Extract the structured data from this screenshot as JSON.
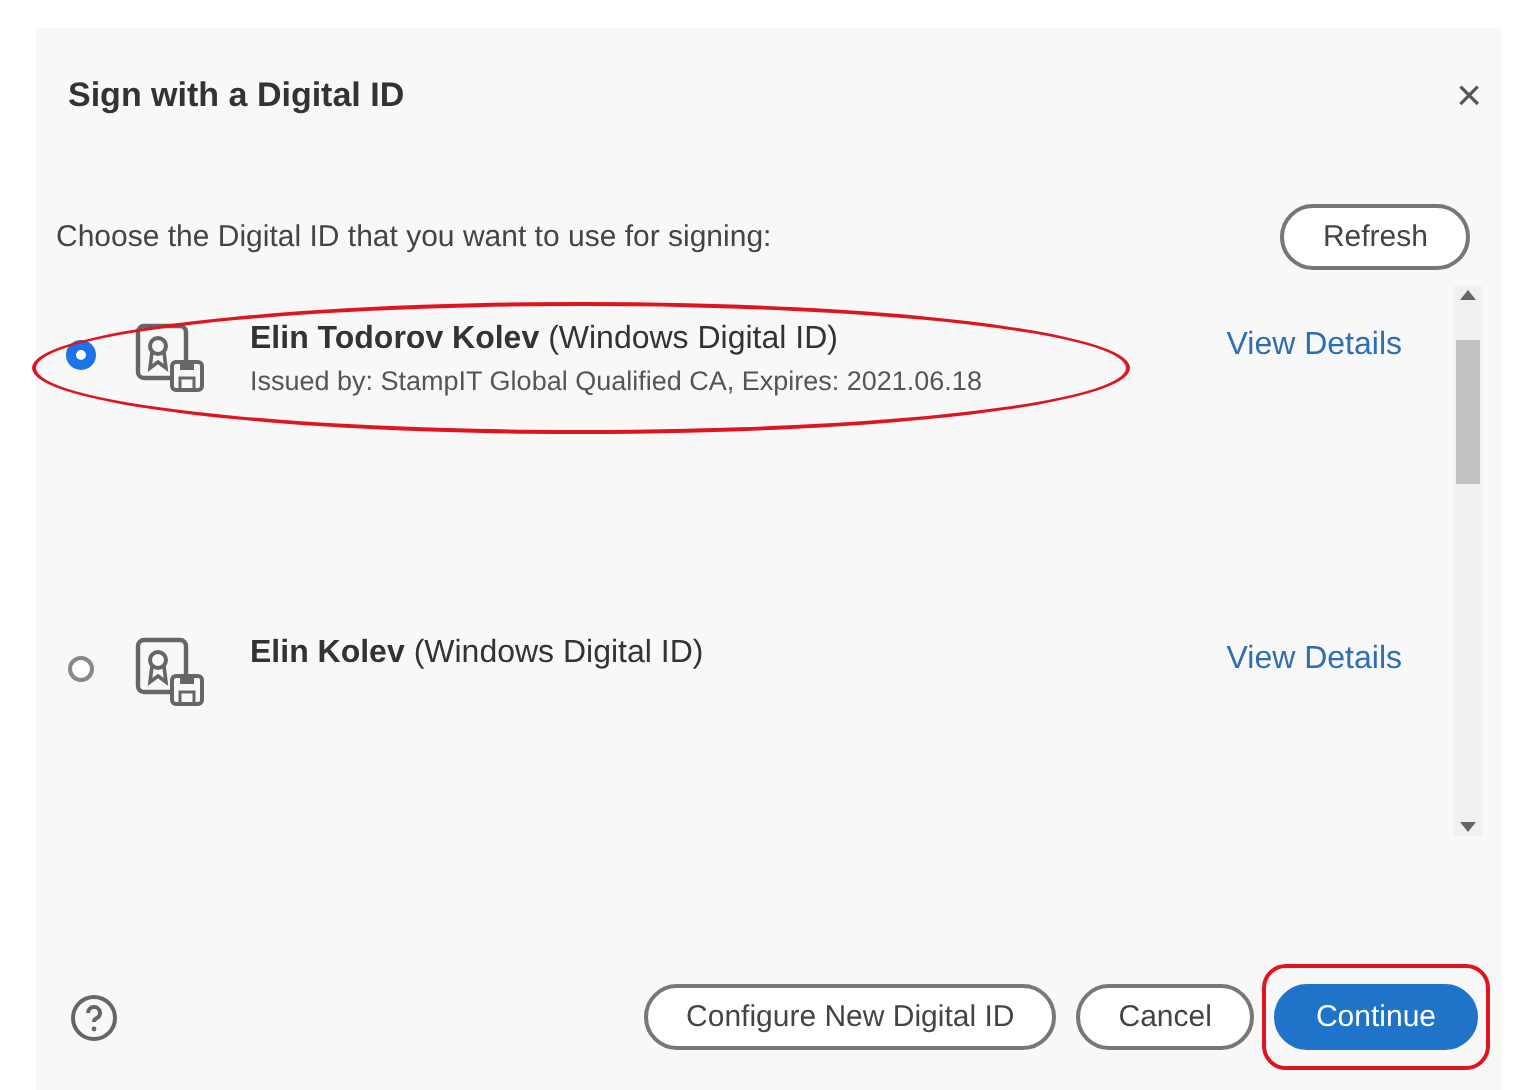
{
  "dialog": {
    "title": "Sign with a Digital ID",
    "close": "×"
  },
  "prompt": "Choose the Digital ID that you want to use for signing:",
  "refresh": "Refresh",
  "ids": [
    {
      "name": "Elin Todorov Kolev",
      "type": "(Windows Digital ID)",
      "issuer": "Issued by: StampIT Global Qualified CA, Expires: 2021.06.18",
      "link": "View Details",
      "selected": true,
      "highlighted": true
    },
    {
      "name": "Elin Kolev",
      "type": "(Windows Digital ID)",
      "link": "View Details",
      "selected": false,
      "highlighted": false
    }
  ],
  "footer": {
    "buttons": [
      {
        "label": "Configure New Digital ID",
        "kind": "secondary",
        "highlighted": false
      },
      {
        "label": "Cancel",
        "kind": "secondary",
        "highlighted": false
      },
      {
        "label": "Continue",
        "kind": "primary",
        "highlighted": true
      }
    ]
  }
}
